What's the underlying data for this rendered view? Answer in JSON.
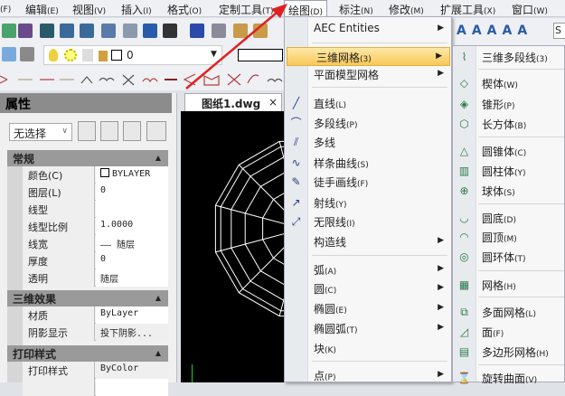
{
  "menubar": {
    "items": [
      {
        "label": "(F)"
      },
      {
        "label": "编辑",
        "key": "(E)"
      },
      {
        "label": "视图",
        "key": "(V)"
      },
      {
        "label": "插入",
        "key": "(I)"
      },
      {
        "label": "格式",
        "key": "(O)"
      },
      {
        "label": "定制工具",
        "key": "(T)"
      },
      {
        "label": "绘图",
        "key": "(D)"
      },
      {
        "label": "标注",
        "key": "(N)"
      },
      {
        "label": "修改",
        "key": "(M)"
      },
      {
        "label": "扩展工具",
        "key": "(X)"
      },
      {
        "label": "窗口",
        "key": "(W)"
      }
    ]
  },
  "toolbar": {
    "layer_value": "0",
    "style_box": "S"
  },
  "properties": {
    "title": "属性",
    "selection": "无选择",
    "sections": [
      {
        "title": "常规",
        "rows": [
          [
            "颜色(C)",
            "BYLAYER"
          ],
          [
            "图层(L)",
            "0"
          ],
          [
            "线型",
            ""
          ],
          [
            "线型比例",
            "1.0000"
          ],
          [
            "线宽",
            "—— 随层"
          ],
          [
            "厚度",
            "0"
          ],
          [
            "透明",
            "随层"
          ]
        ]
      },
      {
        "title": "三维效果",
        "rows": [
          [
            "材质",
            "ByLayer"
          ],
          [
            "阴影显示",
            "投下阴影..."
          ]
        ]
      },
      {
        "title": "打印样式",
        "rows": [
          [
            "打印样式",
            "ByColor"
          ]
        ]
      }
    ]
  },
  "document_tab": {
    "label": "图纸1.dwg",
    "close": "×"
  },
  "draw_menu": {
    "items": [
      {
        "label": "AEC Entities",
        "sub": true
      },
      {
        "label": "三维网格",
        "key": "(3)",
        "sub": true,
        "highlighted": true
      },
      {
        "label": "平面模型网格",
        "sub": true
      },
      {
        "label": "直线",
        "key": "(L)"
      },
      {
        "label": "多段线",
        "key": "(P)"
      },
      {
        "label": "多线"
      },
      {
        "label": "样条曲线",
        "key": "(S)"
      },
      {
        "label": "徒手画线",
        "key": "(F)"
      },
      {
        "label": "射线",
        "key": "(Y)"
      },
      {
        "label": "无限线",
        "key": "(I)"
      },
      {
        "label": "构造线",
        "sub": true
      },
      {
        "label": "弧",
        "key": "(A)",
        "sub": true
      },
      {
        "label": "圆",
        "key": "(C)",
        "sub": true
      },
      {
        "label": "椭圆",
        "key": "(E)",
        "sub": true
      },
      {
        "label": "椭圆弧",
        "key": "(T)",
        "sub": true
      },
      {
        "label": "块",
        "key": "(K)"
      },
      {
        "label": "点",
        "key": "(P)",
        "sub": true
      }
    ]
  },
  "mesh_submenu": {
    "items": [
      {
        "label": "三维多段线",
        "key": "(3)"
      },
      {
        "label": "楔体",
        "key": "(W)"
      },
      {
        "label": "锥形",
        "key": "(P)"
      },
      {
        "label": "长方体",
        "key": "(B)"
      },
      {
        "label": "圆锥体",
        "key": "(C)"
      },
      {
        "label": "圆柱体",
        "key": "(Y)"
      },
      {
        "label": "球体",
        "key": "(S)"
      },
      {
        "label": "圆底",
        "key": "(D)"
      },
      {
        "label": "圆顶",
        "key": "(M)"
      },
      {
        "label": "圆环体",
        "key": "(T)"
      },
      {
        "label": "网格",
        "key": "(H)"
      },
      {
        "label": "多面网格",
        "key": "(L)"
      },
      {
        "label": "面",
        "key": "(F)"
      },
      {
        "label": "多边形网格",
        "key": "(H)"
      },
      {
        "label": "旋转曲面",
        "key": "(V)"
      }
    ]
  },
  "colors": {
    "highlight": "#f8c85a",
    "arrow": "#e02020",
    "canvas": "#000000"
  }
}
